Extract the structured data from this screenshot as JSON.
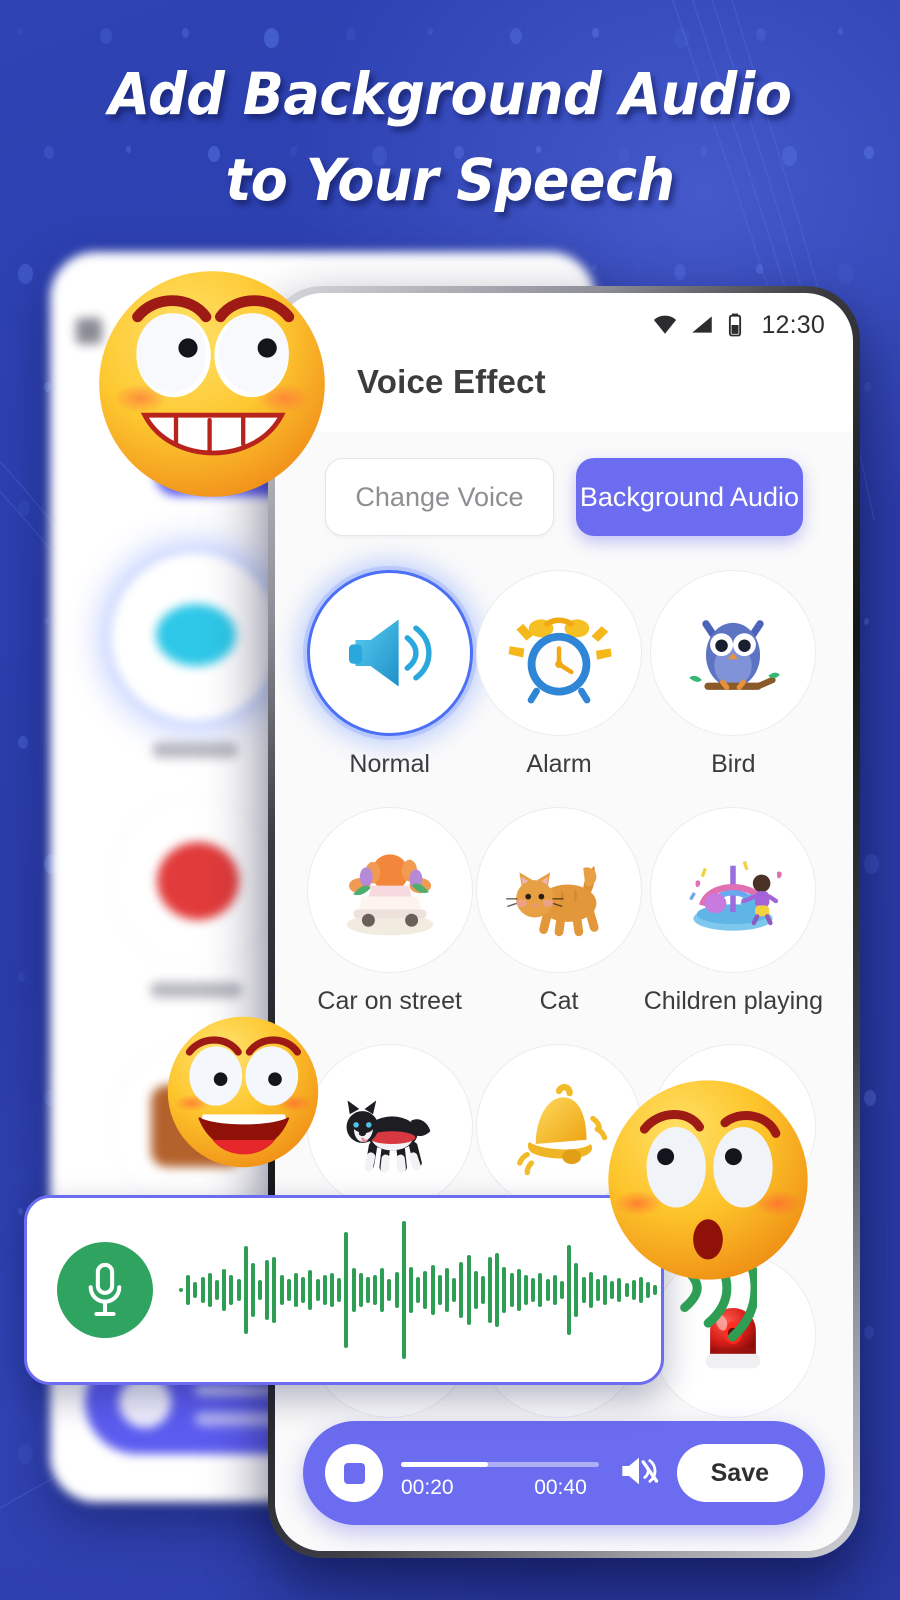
{
  "promo": {
    "headline_line1": "Add Background Audio",
    "headline_line2": "to Your Speech",
    "background_color": "#2b3fad",
    "accent_color": "#6c6cf0"
  },
  "phone": {
    "status_bar": {
      "wifi_icon": "wifi-icon",
      "signal_icon": "cellular-signal-icon",
      "battery_icon": "battery-icon",
      "time": "12:30"
    },
    "app_title": "Voice Effect",
    "tabs": [
      {
        "label": "Change Voice",
        "active": false
      },
      {
        "label": "Background Audio",
        "active": true
      }
    ],
    "effects": [
      {
        "label": "Normal",
        "icon": "speaker-icon",
        "selected": true
      },
      {
        "label": "Alarm",
        "icon": "alarm-clock-icon",
        "selected": false
      },
      {
        "label": "Bird",
        "icon": "owl-icon",
        "selected": false
      },
      {
        "label": "Car on street",
        "icon": "car-icon",
        "selected": false
      },
      {
        "label": "Cat",
        "icon": "cat-icon",
        "selected": false
      },
      {
        "label": "Children playing",
        "icon": "playground-icon",
        "selected": false
      },
      {
        "label": "",
        "icon": "dog-icon",
        "selected": false
      },
      {
        "label": "",
        "icon": "bell-icon",
        "selected": false
      },
      {
        "label": "",
        "icon": "hidden-icon",
        "selected": false
      },
      {
        "label": "",
        "icon": "blank-icon",
        "selected": false
      },
      {
        "label": "",
        "icon": "blank-icon",
        "selected": false
      },
      {
        "label": "",
        "icon": "siren-icon",
        "selected": false
      }
    ],
    "player": {
      "stop_button": "stop-button",
      "current_time": "00:20",
      "total_time": "00:40",
      "progress_percent": 44,
      "mute_icon": "speaker-mute-icon",
      "save_label": "Save"
    }
  },
  "recorder_card": {
    "mic_icon": "microphone-icon",
    "waveform_color": "#2e9e54",
    "sound_waves_icon": "sound-waves-icon"
  },
  "decorations": {
    "emoji_grinning": "grinning-face-emoji",
    "emoji_laughing": "laughing-face-emoji",
    "emoji_surprised": "surprised-face-emoji"
  }
}
